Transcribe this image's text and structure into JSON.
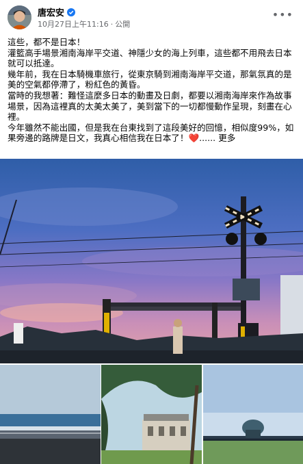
{
  "post": {
    "author": "唐宏安",
    "timestamp": "10月27日上午11:16",
    "separator": "·",
    "privacy": "公開",
    "lines": [
      "這些，都不是日本！",
      "灌籃高手場景湘南海岸平交道、神隱少女的海上列車，這些都不用飛去日本就可以抵達。",
      "幾年前，我在日本騎機車旅行，從東京騎到湘南海岸平交道，那氣氛真的是美的空氣都停滯了，粉紅色的黃昏。",
      "當時的我想著：難怪這麼多日本的動畫及日劇，都要以湘南海岸來作為故事場景，因為這裡真的太美太美了，美到當下的一切都慢動作呈現，刻畫在心裡。"
    ],
    "last_line": "今年雖然不能出國，但是我在台東找到了這段美好的回憶，相似度99%，如果旁邊的路牌是日文，我真心相信我在日本了！",
    "heart": "❤️",
    "ellipsis": "......",
    "see_more": "更多"
  },
  "icons": {
    "verified": "verified-badge-icon",
    "privacy": "globe-icon",
    "more": "more-options-icon"
  },
  "colors": {
    "accent": "#1877f2",
    "meta": "#65676b",
    "heart": "#e41e3f"
  }
}
